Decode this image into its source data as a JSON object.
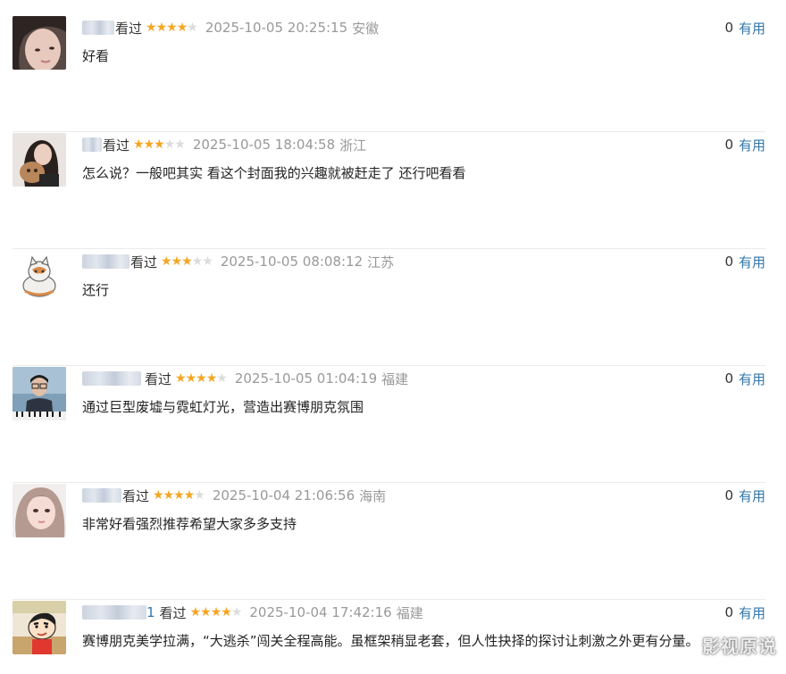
{
  "comments": [
    {
      "user_suffix": "",
      "status": "看过",
      "rating": 4,
      "time": "2025-10-05 20:25:15",
      "region": "安徽",
      "vote_count": "0",
      "vote_label": "有用",
      "text": "好看",
      "avatar_icon": "avatar-girl-portrait-icon"
    },
    {
      "user_suffix": "",
      "status": "看过",
      "rating": 3,
      "time": "2025-10-05 18:04:58",
      "region": "浙江",
      "vote_count": "0",
      "vote_label": "有用",
      "text": "怎么说？一般吧其实 看这个封面我的兴趣就被赶走了 还行吧看看",
      "avatar_icon": "avatar-girl-with-cat-icon"
    },
    {
      "user_suffix": "",
      "status": "看过",
      "rating": 3,
      "time": "2025-10-05 08:08:12",
      "region": "江苏",
      "vote_count": "0",
      "vote_label": "有用",
      "text": "还行",
      "avatar_icon": "avatar-cartoon-cat-icon"
    },
    {
      "user_suffix": "",
      "status": "看过",
      "rating": 4,
      "time": "2025-10-05 01:04:19",
      "region": "福建",
      "vote_count": "0",
      "vote_label": "有用",
      "text": "通过巨型废墟与霓虹灯光，营造出赛博朋克氛围",
      "avatar_icon": "avatar-boy-piano-icon"
    },
    {
      "user_suffix": "",
      "status": "看过",
      "rating": 4,
      "time": "2025-10-04 21:06:56",
      "region": "海南",
      "vote_count": "0",
      "vote_label": "有用",
      "text": "非常好看强烈推荐希望大家多多支持",
      "avatar_icon": "avatar-girl-selfie-icon"
    },
    {
      "user_suffix": "1",
      "status": "看过",
      "rating": 4,
      "time": "2025-10-04 17:42:16",
      "region": "福建",
      "vote_count": "0",
      "vote_label": "有用",
      "text": "赛博朋克美学拉满，“大逃杀”闯关全程高能。虽框架稍显老套，但人性抉择的探讨让刺激之外更有分量。",
      "avatar_icon": "avatar-crayon-shinchan-icon"
    }
  ],
  "watermark": "影视原说",
  "colors": {
    "star_on": "#f5a623",
    "star_off": "#dcdcdc",
    "link": "#3377aa",
    "meta_gray": "#999999"
  }
}
